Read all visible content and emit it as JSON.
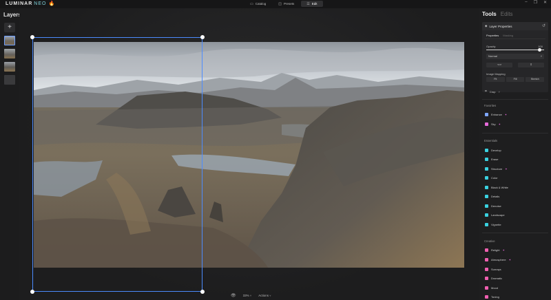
{
  "app": {
    "logo_text": "LUMINAR",
    "logo_suffix": "NEO",
    "logo_flame": "🔥"
  },
  "nav": {
    "items": [
      {
        "label": "Catalog",
        "icon": "catalog-icon",
        "glyph": "▭"
      },
      {
        "label": "Presets",
        "icon": "presets-icon",
        "glyph": "◫"
      },
      {
        "label": "Edit",
        "icon": "edit-icon",
        "glyph": "☰"
      }
    ],
    "active": "Edit"
  },
  "window_controls": {
    "minimize": "–",
    "maximize": "❐",
    "close": "✕"
  },
  "layers": {
    "title": "Layers",
    "add_glyph": "+"
  },
  "canvas": {
    "zoom": "33%",
    "actions_label": "Actions",
    "eye_glyph": "👁",
    "selection_color": "#4c8cff"
  },
  "right_panel": {
    "tabs": {
      "tools": "Tools",
      "edits": "Edits"
    },
    "layer_properties": {
      "title": "Layer Properties",
      "reset_glyph": "↺",
      "subtabs": [
        "Properties",
        "Masking"
      ],
      "opacity_label": "Opacity",
      "opacity_value": "100",
      "blend_mode": "Normal",
      "flip_h": "⟺",
      "flip_v": "⇕",
      "image_mapping_label": "Image Mapping",
      "mapping_options": [
        "Fit",
        "Fill",
        "Stretch"
      ]
    },
    "crop_label": "Crop",
    "sections": {
      "favorites": "Favorites",
      "essentials": "Essentials",
      "creative": "Creative"
    },
    "favorites": [
      {
        "label": "Enhance",
        "color": "#7fa7ff",
        "ai": true
      },
      {
        "label": "Sky",
        "color": "#e56ad9",
        "ai": true
      }
    ],
    "essentials": [
      {
        "label": "Develop",
        "color": "#3ad1e0"
      },
      {
        "label": "Erase",
        "color": "#3ad1e0"
      },
      {
        "label": "Structure",
        "color": "#3ad1e0",
        "ai": true
      },
      {
        "label": "Color",
        "color": "#3ad1e0"
      },
      {
        "label": "Black & White",
        "color": "#3ad1e0"
      },
      {
        "label": "Details",
        "color": "#3ad1e0"
      },
      {
        "label": "Denoise",
        "color": "#3ad1e0"
      },
      {
        "label": "Landscape",
        "color": "#3ad1e0"
      },
      {
        "label": "Vignette",
        "color": "#3ad1e0"
      }
    ],
    "creative": [
      {
        "label": "Relight",
        "color": "#f05fb0",
        "ai": true
      },
      {
        "label": "Atmosphere",
        "color": "#f05fb0",
        "ai": true
      },
      {
        "label": "Sunrays",
        "color": "#f05fb0"
      },
      {
        "label": "Dramatic",
        "color": "#f05fb0"
      },
      {
        "label": "Mood",
        "color": "#f05fb0"
      },
      {
        "label": "Toning",
        "color": "#f05fb0"
      }
    ]
  }
}
